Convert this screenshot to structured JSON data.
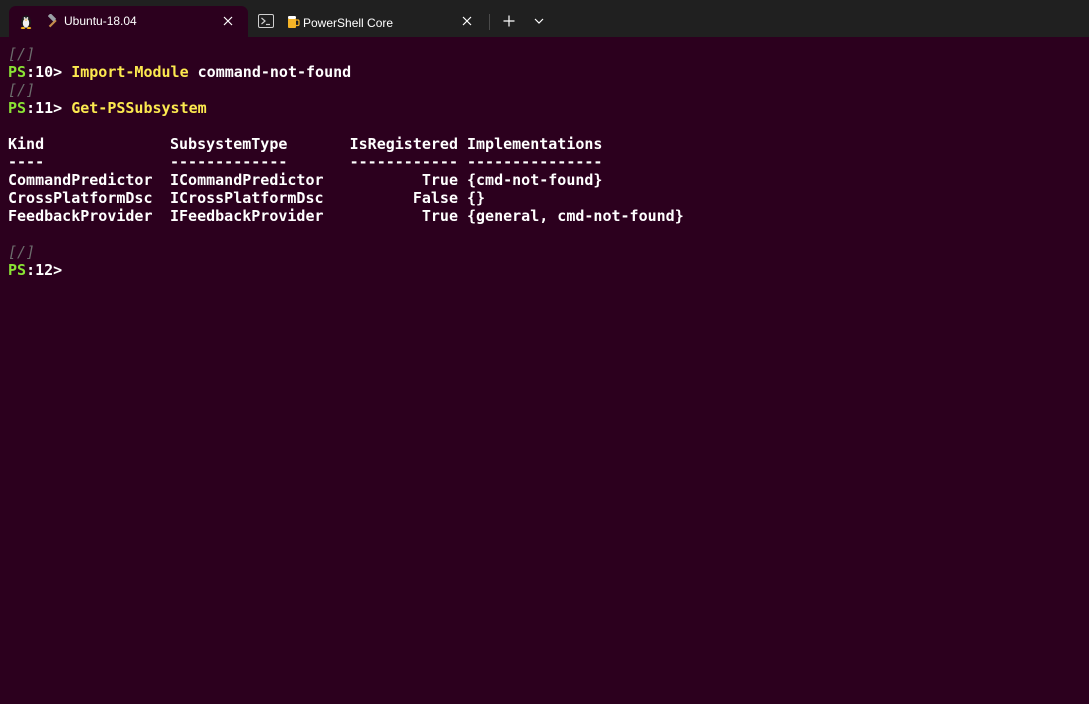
{
  "tabs": [
    {
      "label": "Ubuntu-18.04",
      "icon": "linux-penguin-icon",
      "sub_icon": "hammer-icon",
      "active": true,
      "close_label": "✕"
    },
    {
      "label": "PowerShell Core",
      "icon": "powershell-icon",
      "sub_icon": "beer-mug-icon",
      "active": false,
      "close_label": "✕"
    }
  ],
  "tabbar": {
    "new_tab_label": "+",
    "dropdown_label": "⌄"
  },
  "terminal": {
    "colors": {
      "background": "#2c001e",
      "prompt_ps": "#8ae234",
      "command": "#fce94f",
      "path": "#6c6c6c",
      "text": "#ffffff"
    },
    "path_marker": "[/]",
    "prompts": [
      {
        "ps": "PS",
        "num": ":10>",
        "command": "Import-Module",
        "args": " command-not-found"
      },
      {
        "ps": "PS",
        "num": ":11>",
        "command": "Get-PSSubsystem",
        "args": ""
      },
      {
        "ps": "PS",
        "num": ":12>",
        "command": "",
        "args": ""
      }
    ],
    "table": {
      "headers": [
        "Kind",
        "SubsystemType",
        "IsRegistered",
        "Implementations"
      ],
      "underlines": [
        "----",
        "-------------",
        "------------",
        "---------------"
      ],
      "rows": [
        [
          "CommandPredictor",
          "ICommandPredictor",
          "True",
          "{cmd-not-found}"
        ],
        [
          "CrossPlatformDsc",
          "ICrossPlatformDsc",
          "False",
          "{}"
        ],
        [
          "FeedbackProvider",
          "IFeedbackProvider",
          "True",
          "{general, cmd-not-found}"
        ]
      ]
    }
  }
}
